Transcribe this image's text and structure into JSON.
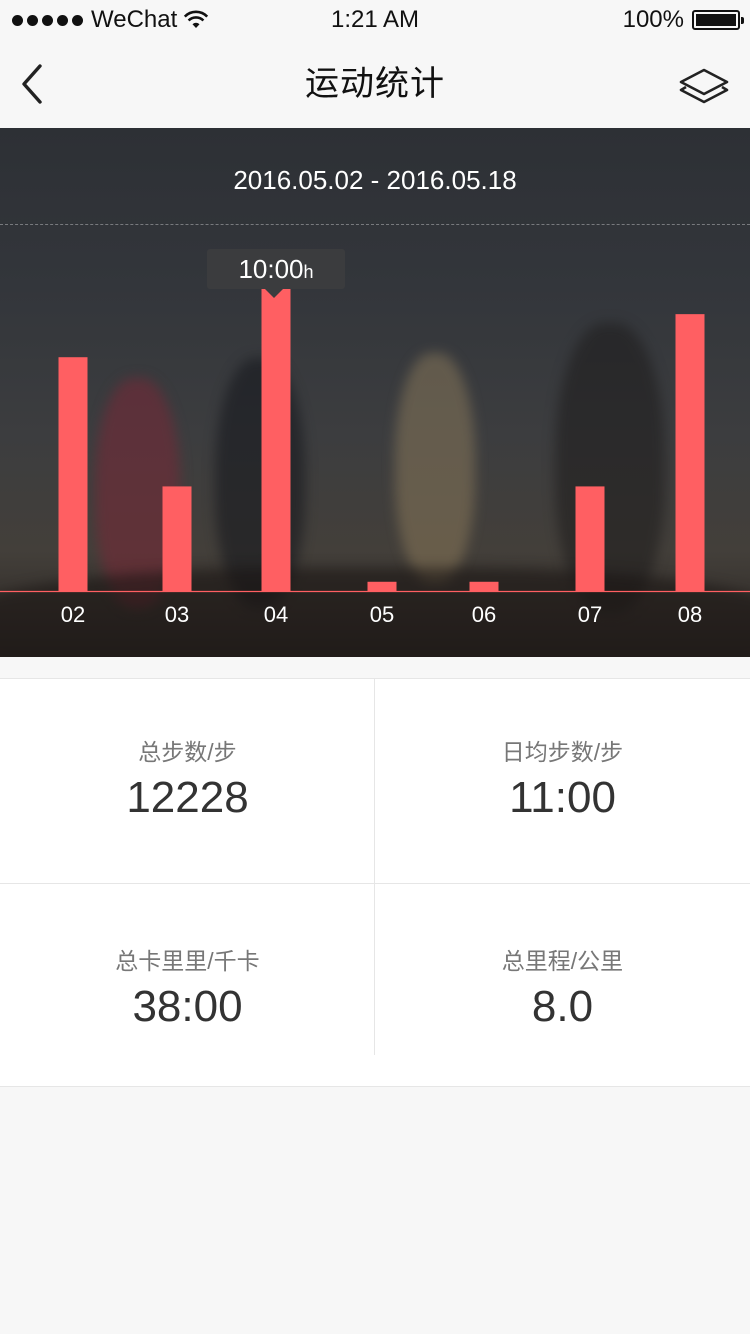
{
  "status_bar": {
    "carrier": "WeChat",
    "time": "1:21 AM",
    "battery": "100%"
  },
  "nav": {
    "title": "运动统计"
  },
  "hero": {
    "date_range": "2016.05.02 - 2016.05.18",
    "tooltip": {
      "value": "10:00",
      "unit": "h"
    }
  },
  "chart_data": {
    "type": "bar",
    "categories": [
      "02",
      "03",
      "04",
      "05",
      "06",
      "07",
      "08"
    ],
    "values": [
      7.6,
      3.4,
      10.0,
      0.3,
      0.3,
      3.4,
      9.0
    ],
    "highlighted_index": 2,
    "bar_color": "#ff5f62",
    "ylim": [
      0,
      10.5
    ],
    "grid": false
  },
  "stats": [
    {
      "label": "总步数/步",
      "value": "12228"
    },
    {
      "label": "日均步数/步",
      "value": "11:00"
    },
    {
      "label": "总卡里里/千卡",
      "value": "38:00"
    },
    {
      "label": "总里程/公里",
      "value": "8.0"
    }
  ],
  "colors": {
    "accent": "#ff5f62",
    "background": "#f7f7f7"
  }
}
